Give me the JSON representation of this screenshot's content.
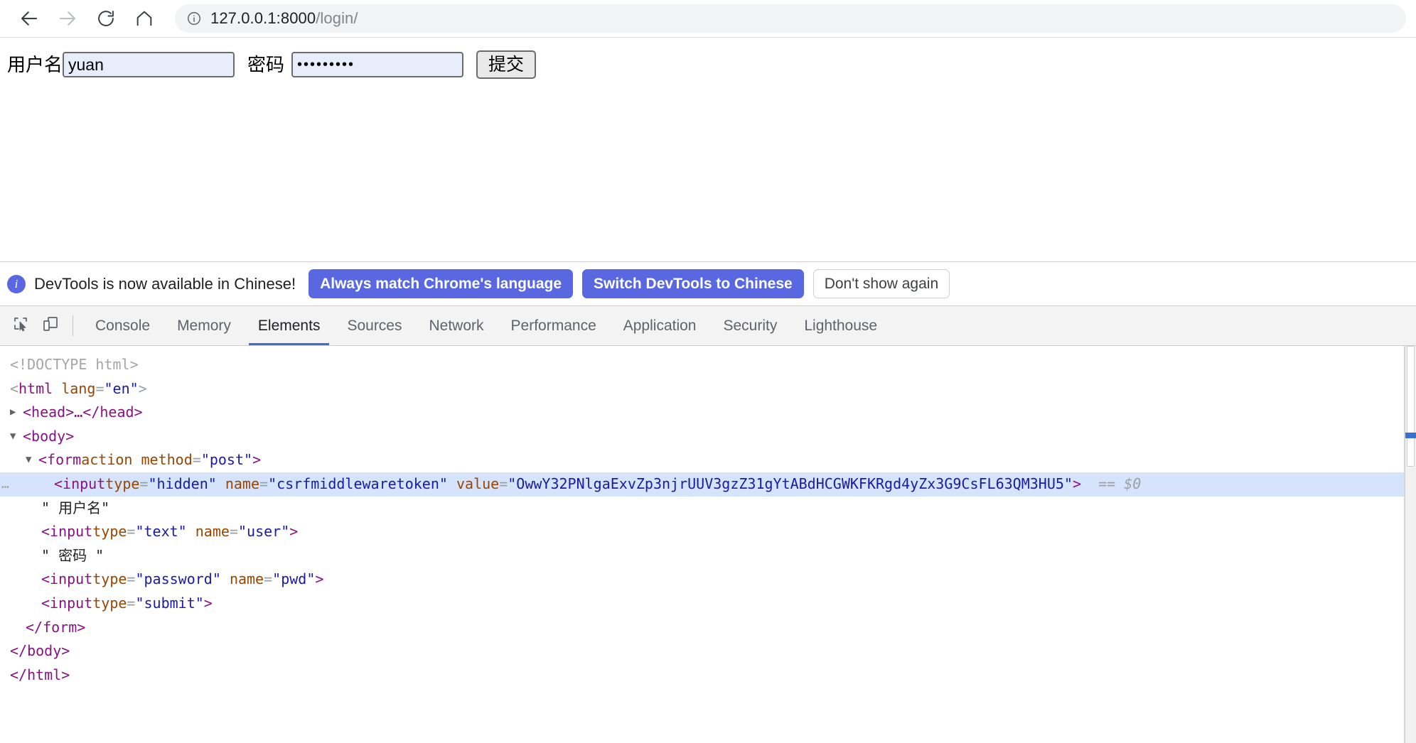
{
  "browser": {
    "nav": {
      "back_icon": "arrow-left-icon",
      "forward_icon": "arrow-right-icon",
      "reload_icon": "reload-icon",
      "home_icon": "home-icon"
    },
    "omnibox": {
      "info_icon": "info-circle-icon",
      "url_host": "127.0.0.1:8000",
      "url_path": "/login/"
    }
  },
  "page": {
    "form": {
      "username_label": "用户名",
      "username_value": "yuan",
      "password_label": "密码",
      "password_value": "•••••••••",
      "submit_label": "提交"
    }
  },
  "devtools": {
    "infobar": {
      "icon": "info-circle-icon",
      "message": "DevTools is now available in Chinese!",
      "buttons": [
        {
          "label": "Always match Chrome's language",
          "style": "primary"
        },
        {
          "label": "Switch DevTools to Chinese",
          "style": "primary"
        },
        {
          "label": "Don't show again",
          "style": "secondary"
        }
      ]
    },
    "toolbar": {
      "inspect_icon": "inspect-element-icon",
      "device_icon": "device-toolbar-icon"
    },
    "tabs": [
      {
        "label": "Console",
        "active": false
      },
      {
        "label": "Memory",
        "active": false
      },
      {
        "label": "Elements",
        "active": true
      },
      {
        "label": "Sources",
        "active": false
      },
      {
        "label": "Network",
        "active": false
      },
      {
        "label": "Performance",
        "active": false
      },
      {
        "label": "Application",
        "active": false
      },
      {
        "label": "Security",
        "active": false
      },
      {
        "label": "Lighthouse",
        "active": false
      }
    ],
    "dom": {
      "doctype": "<!DOCTYPE html>",
      "html_open_lt": "<",
      "html_tag": "html",
      "html_attr_lang": "lang",
      "html_attr_lang_value": "\"en\"",
      "html_open_gt": ">",
      "head_collapsed": "<head>…</head>",
      "body_open": "<body>",
      "form_open_pre": "<form ",
      "form_attr_action": "action",
      "form_attr_method": "method",
      "form_attr_method_value": "\"post\"",
      "form_open_gt": ">",
      "csrf_input_pre": "<input ",
      "csrf_attr_type": "type",
      "csrf_attr_type_value": "\"hidden\"",
      "csrf_attr_name": "name",
      "csrf_attr_name_value": "\"csrfmiddlewaretoken\"",
      "csrf_attr_value": "value",
      "csrf_attr_value_value": "\"OwwY32PNlgaExvZp3njrUUV3gzZ31gYtABdHCGWKFKRgd4yZx3G9CsFL63QM3HU5\"",
      "csrf_close_gt": ">",
      "csrf_selected_marker": "== $0",
      "ellipsis_gutter": "…",
      "text_username": "\" 用户名\"",
      "user_input_pre": "<input ",
      "user_attr_type": "type",
      "user_attr_type_value": "\"text\"",
      "user_attr_name": "name",
      "user_attr_name_value": "\"user\"",
      "user_close_gt": ">",
      "text_password": "\" 密码 \"",
      "pwd_input_pre": "<input ",
      "pwd_attr_type": "type",
      "pwd_attr_type_value": "\"password\"",
      "pwd_attr_name": "name",
      "pwd_attr_name_value": "\"pwd\"",
      "pwd_close_gt": ">",
      "submit_input_pre": "<input ",
      "submit_attr_type": "type",
      "submit_attr_type_value": "\"submit\"",
      "submit_close_gt": ">",
      "form_close": "</form>",
      "body_close": "</body>",
      "html_close": "</html>",
      "twisty_collapsed": "▶",
      "twisty_expanded": "▼"
    }
  },
  "colors": {
    "accent_blue": "#5968e0",
    "tab_underline": "#3b6fd4",
    "selected_row": "#d6e4fb",
    "input_bg": "#e8edfb",
    "tag_purple": "#881280",
    "attr_orange": "#994500",
    "value_blue": "#1a1aa6"
  }
}
